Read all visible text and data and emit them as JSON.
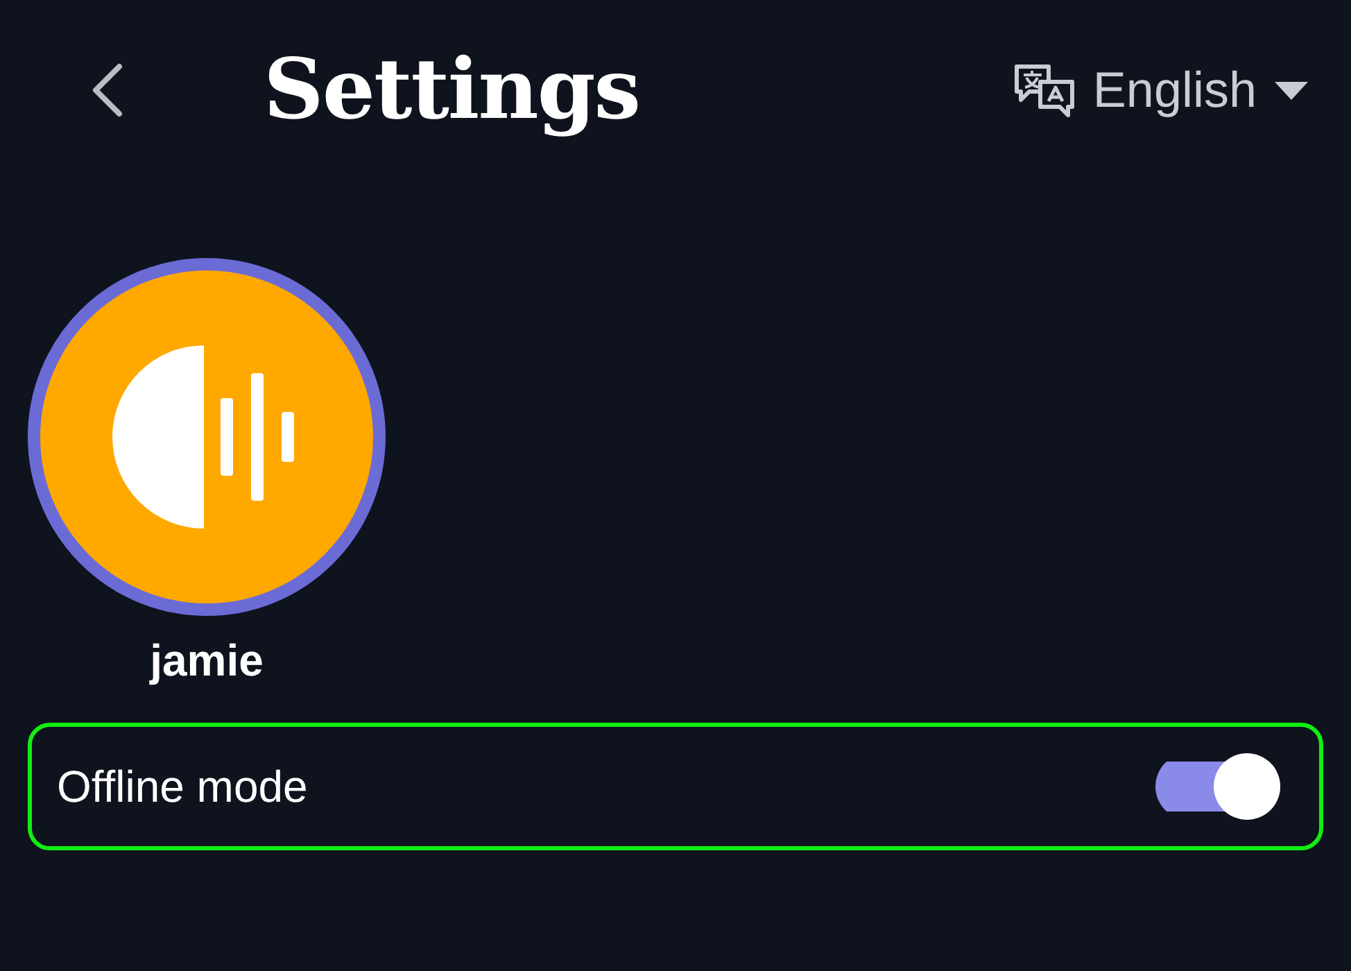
{
  "header": {
    "title": "Settings",
    "language": "English"
  },
  "profile": {
    "name": "jamie"
  },
  "settings": [
    {
      "kind": "toggle",
      "label": "Offline mode",
      "on": true,
      "focused": true
    }
  ]
}
